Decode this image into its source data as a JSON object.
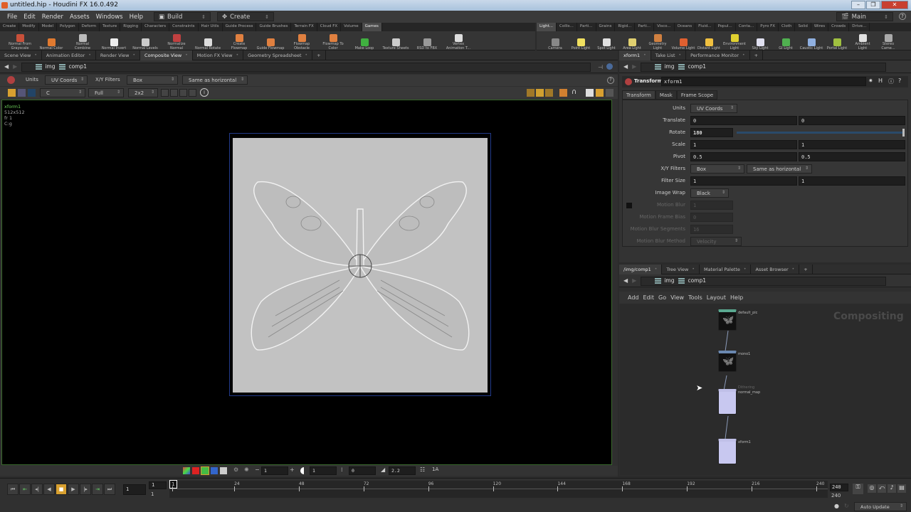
{
  "window": {
    "title": "untitled.hip - Houdini FX 16.0.492",
    "controls": [
      "–",
      "❐",
      "✕"
    ]
  },
  "menu": {
    "items": [
      "File",
      "Edit",
      "Render",
      "Assets",
      "Windows",
      "Help"
    ],
    "desktop": "Build",
    "create": "Create",
    "main": "Main",
    "help_icon": "?"
  },
  "shelf_left": {
    "tabs": [
      "Create",
      "Modify",
      "Model",
      "Polygon",
      "Deform",
      "Texture",
      "Rigging",
      "Characters",
      "Constraints",
      "Hair Utils",
      "Guide Process",
      "Guide Brushes",
      "Terrain FX",
      "Cloud FX",
      "Volume",
      "Games"
    ],
    "active_tab": "Games",
    "tools": [
      {
        "label": "Normal From Grayscale",
        "color": "#c8503a"
      },
      {
        "label": "Normal Color",
        "color": "#e07a30"
      },
      {
        "label": "Normal Combine",
        "color": "#bbbbbb"
      },
      {
        "label": "Normal Invert",
        "color": "#eeeeee"
      },
      {
        "label": "Normal Levels",
        "color": "#cccccc"
      },
      {
        "label": "Normalize Normal",
        "color": "#c04040"
      },
      {
        "label": "Normal Rotate",
        "color": "#dddddd"
      },
      {
        "label": "Create Flowmap",
        "color": "#e08040"
      },
      {
        "label": "Guide Flowmap",
        "color": "#e08040"
      },
      {
        "label": "Flowmap Obstacle",
        "color": "#e08040"
      },
      {
        "label": "Flowmap To Color",
        "color": "#e08040"
      },
      {
        "label": "Make Loop",
        "color": "#40b040"
      },
      {
        "label": "Texture Sheets",
        "color": "#cccccc"
      },
      {
        "label": "RSD to FBX",
        "color": "#999999"
      },
      {
        "label": "Vertex Animation T...",
        "color": "#dddddd"
      }
    ]
  },
  "shelf_right": {
    "tabs": [
      "Light...",
      "Collis...",
      "Parti...",
      "Grains",
      "Rigid...",
      "Parti...",
      "Visco...",
      "Oceans",
      "Fluid...",
      "Popul...",
      "Conta...",
      "Pyro FX",
      "Cloth",
      "Solid",
      "Wires",
      "Crowds",
      "Drive..."
    ],
    "active_tab": "Light...",
    "tools": [
      {
        "label": "Camera",
        "color": "#888888"
      },
      {
        "label": "Point Light",
        "color": "#f0e060"
      },
      {
        "label": "Spot Light",
        "color": "#e0e0e0"
      },
      {
        "label": "Area Light",
        "color": "#e0d070"
      },
      {
        "label": "Geometry Light",
        "color": "#d08040"
      },
      {
        "label": "Volume Light",
        "color": "#e06030"
      },
      {
        "label": "Distant Light",
        "color": "#f0c040"
      },
      {
        "label": "Environment Light",
        "color": "#e0d030"
      },
      {
        "label": "Sky Light",
        "color": "#e0e0f0"
      },
      {
        "label": "GI Light",
        "color": "#50b050"
      },
      {
        "label": "Caustic Light",
        "color": "#90b0e0"
      },
      {
        "label": "Portal Light",
        "color": "#a0c040"
      },
      {
        "label": "Ambient Light",
        "color": "#e0e0e0"
      },
      {
        "label": "Stereo Came...",
        "color": "#aaaaaa"
      }
    ]
  },
  "left_pane": {
    "tabs": [
      "Scene View",
      "Animation Editor",
      "Render View",
      "Composite View",
      "Motion FX View",
      "Geometry Spreadsheet"
    ],
    "active_tab": "Composite View",
    "path": [
      "img",
      "comp1"
    ],
    "toolbar": {
      "units_label": "Units",
      "units": "UV Coords",
      "filters_label": "X/Y Filters",
      "filter": "Box",
      "filter_v": "Same as horizontal",
      "channel": "C",
      "res": "Full",
      "tile": "2x2"
    },
    "info": {
      "node": "xform1",
      "res": "512x512",
      "frame": "fr 1",
      "plane": "C:g"
    },
    "bottom": {
      "value1": "1",
      "value2": "1",
      "value3": "0",
      "gamma": "2.2"
    }
  },
  "param_pane": {
    "tabs": [
      "xform1",
      "Take List",
      "Performance Monitor"
    ],
    "active_tab": "xform1",
    "path": [
      "img",
      "comp1"
    ],
    "node_type": "Transform",
    "node_name": "xform1",
    "sub_tabs": [
      "Transform",
      "Mask",
      "Frame Scope"
    ],
    "params": {
      "units": {
        "label": "Units",
        "value": "UV Coords"
      },
      "translate": {
        "label": "Translate",
        "x": "0",
        "y": "0"
      },
      "rotate": {
        "label": "Rotate",
        "value": "180",
        "slider_fraction": 1.0
      },
      "scale": {
        "label": "Scale",
        "x": "1",
        "y": "1"
      },
      "pivot": {
        "label": "Pivot",
        "x": "0.5",
        "y": "0.5"
      },
      "filters": {
        "label": "X/Y Filters",
        "x": "Box",
        "y": "Same as horizontal"
      },
      "filter_size": {
        "label": "Filter Size",
        "x": "1",
        "y": "1"
      },
      "image_wrap": {
        "label": "Image Wrap",
        "value": "Black"
      },
      "motion_blur": {
        "label": "Motion Blur",
        "value": "1"
      },
      "motion_frame_bias": {
        "label": "Motion Frame Bias",
        "value": "0"
      },
      "motion_blur_segments": {
        "label": "Motion Blur Segments",
        "value": "16"
      },
      "motion_blur_method": {
        "label": "Motion Blur Method",
        "value": "Velocity"
      }
    }
  },
  "network_pane": {
    "tabs": [
      "/img/comp1",
      "Tree View",
      "Material Palette",
      "Asset Browser"
    ],
    "active_tab": "/img/comp1",
    "path": [
      "img",
      "comp1"
    ],
    "menu": [
      "Add",
      "Edit",
      "Go",
      "View",
      "Tools",
      "Layout",
      "Help"
    ],
    "context_label": "Compositing",
    "nodes": [
      {
        "name": "default_pic",
        "color": "#5aa890"
      },
      {
        "name": "mono1",
        "color": "#6a88b0"
      },
      {
        "name": "normal_map",
        "color": "#c0c0e8",
        "note": "Dithering"
      },
      {
        "name": "xform1",
        "color": "#c0c0e8"
      }
    ]
  },
  "timeline": {
    "current_frame": "1",
    "start": "1",
    "start2": "1",
    "ticks": [
      "1",
      "24",
      "48",
      "72",
      "96",
      "120",
      "144",
      "168",
      "192",
      "216",
      "240"
    ],
    "end": "240",
    "end2": "240",
    "update_mode": "Auto Update"
  }
}
